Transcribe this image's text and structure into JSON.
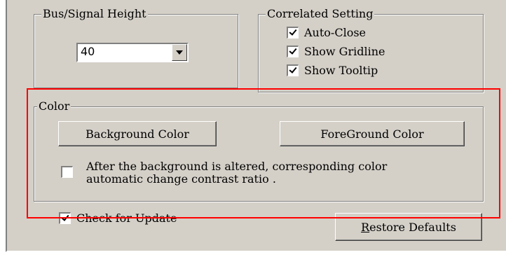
{
  "bus_signal_group": {
    "title": "Bus/Signal Height",
    "height_value": "40"
  },
  "correlated_group": {
    "title": "Correlated Setting",
    "options": [
      {
        "label": "Auto-Close",
        "checked": true
      },
      {
        "label": "Show Gridline",
        "checked": true
      },
      {
        "label": "Show Tooltip",
        "checked": true
      }
    ]
  },
  "color_group": {
    "title": "Color",
    "background_button": "Background Color",
    "foreground_button": "ForeGround Color",
    "auto_contrast": {
      "line1": "After the background is altered, corresponding color",
      "line2": "automatic change contrast ratio .",
      "checked": false
    }
  },
  "check_update": {
    "label": "Check for Update",
    "checked": true
  },
  "restore": {
    "accel": "R",
    "rest": "estore Defaults"
  },
  "highlight_color": "#ff0000"
}
